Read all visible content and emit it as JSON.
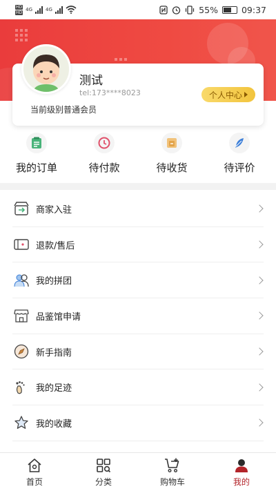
{
  "status_bar": {
    "hd_label": "HD",
    "sim1_label": "4G",
    "sim2_label": "4G",
    "battery": "55%",
    "time": "09:37"
  },
  "profile": {
    "name": "测试",
    "tel": "tel:173****8023",
    "level": "当前级别普通会员",
    "center_button": "个人中心"
  },
  "orders": [
    {
      "label": "我的订单",
      "icon": "order-list-icon",
      "color": "#49b37a"
    },
    {
      "label": "待付款",
      "icon": "clock-icon",
      "color": "#e0506a"
    },
    {
      "label": "待收货",
      "icon": "package-icon",
      "color": "#e2a34a"
    },
    {
      "label": "待评价",
      "icon": "feather-icon",
      "color": "#3d7fd8"
    }
  ],
  "menu": [
    {
      "label": "商家入驻",
      "icon": "store-entry-icon"
    },
    {
      "label": "退款/售后",
      "icon": "refund-icon"
    },
    {
      "label": "我的拼团",
      "icon": "group-icon"
    },
    {
      "label": "品鉴馆申请",
      "icon": "shop-icon"
    },
    {
      "label": "新手指南",
      "icon": "guide-icon"
    },
    {
      "label": "我的足迹",
      "icon": "footprint-icon"
    },
    {
      "label": "我的收藏",
      "icon": "star-icon"
    }
  ],
  "tabbar": [
    {
      "label": "首页",
      "icon": "home-icon"
    },
    {
      "label": "分类",
      "icon": "category-icon"
    },
    {
      "label": "购物车",
      "icon": "cart-icon"
    },
    {
      "label": "我的",
      "icon": "profile-icon",
      "active": true
    }
  ],
  "colors": {
    "header_red": "#ea3c3c",
    "accent_gold": "#f2c43d",
    "active_tab": "#b3242a"
  }
}
